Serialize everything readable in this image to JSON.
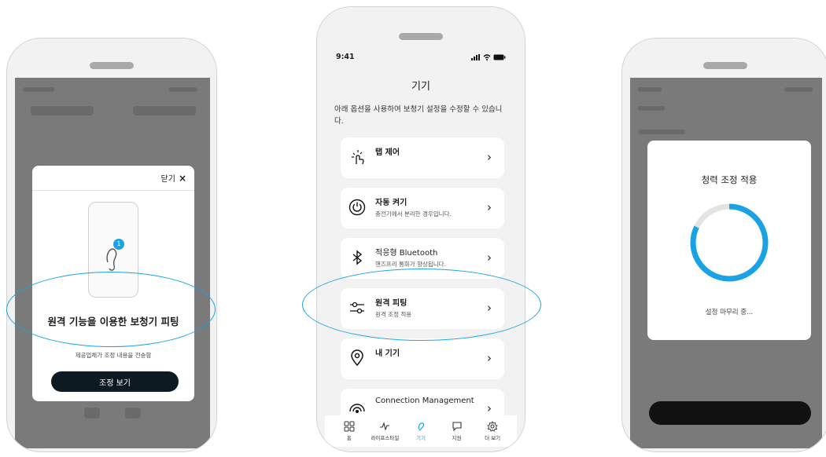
{
  "phone_left": {
    "modal": {
      "close_label": "닫기",
      "close_icon": "×",
      "badge_count": "1",
      "title": "원격 기능을 이용한 보청기 피팅",
      "subtitle": "제공업체가 조정 내용을 전송함",
      "button_label": "조정 보기"
    }
  },
  "phone_center": {
    "status": {
      "time": "9:41"
    },
    "page_title": "기기",
    "intro": "아래 옵션을 사용하여 보청기 설정을 수정할 수 있습니다.",
    "cards": [
      {
        "title": "탭 제어",
        "desc": "",
        "icon": "tap-hand-icon"
      },
      {
        "title": "자동 켜기",
        "desc": "충전기에서 분리한 경우입니다.",
        "icon": "power-icon"
      },
      {
        "title": "적응형 Bluetooth",
        "desc": "핸즈프리 통화가 향상됩니다.",
        "icon": "bluetooth-icon"
      },
      {
        "title": "원격 피팅",
        "desc": "원격 조정 적용",
        "icon": "sliders-icon"
      },
      {
        "title": "내 기기",
        "desc": "",
        "icon": "location-pin-icon"
      },
      {
        "title": "Connection Management",
        "desc": "",
        "icon": "connection-icon"
      }
    ],
    "chevron": "›",
    "tabs": [
      {
        "label": "홈",
        "icon": "grid-icon",
        "active": false
      },
      {
        "label": "라이프스타일",
        "icon": "activity-icon",
        "active": false
      },
      {
        "label": "기기",
        "icon": "hearing-aid-icon",
        "active": true
      },
      {
        "label": "지원",
        "icon": "chat-icon",
        "active": false
      },
      {
        "label": "더 보기",
        "icon": "gear-icon",
        "active": false
      }
    ]
  },
  "phone_right": {
    "card_title": "청력 조정 적용",
    "status_text": "설정 마무리 중...",
    "progress_fraction": 0.82
  },
  "colors": {
    "accent": "#1aa3e4",
    "dark_button": "#0e1a22",
    "overlay": "#7a7a7a"
  }
}
